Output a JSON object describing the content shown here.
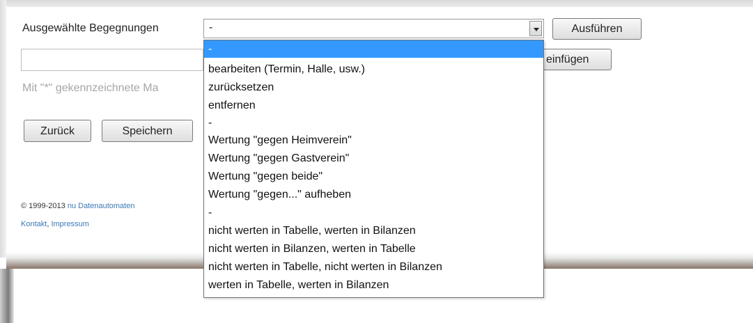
{
  "form": {
    "selected_label": "Ausgewählte Begegnungen",
    "select_value": "-",
    "execute_button": "Ausführen",
    "insert_button_visible_text": "einfügen",
    "hint_text": "Mit \"*\" gekennzeichnete Ma",
    "back_button": "Zurück",
    "save_button": "Speichern"
  },
  "footer": {
    "copyright": "© 1999-2013",
    "company_link": "nu Datenautomaten",
    "contact_link": "Kontakt",
    "separator": ",",
    "imprint_link": "Impressum"
  },
  "dropdown": {
    "options": [
      "-",
      "bearbeiten (Termin, Halle, usw.)",
      "zurücksetzen",
      "entfernen",
      "-",
      "Wertung \"gegen Heimverein\"",
      "Wertung \"gegen Gastverein\"",
      "Wertung \"gegen beide\"",
      "Wertung \"gegen...\" aufheben",
      "-",
      "nicht werten in Tabelle, werten in Bilanzen",
      "nicht werten in Bilanzen, werten in Tabelle",
      "nicht werten in Tabelle, nicht werten in Bilanzen",
      "werten in Tabelle, werten in Bilanzen"
    ],
    "selected_index": 0
  },
  "colors": {
    "highlight": "#3399ff",
    "link": "#3b79b6"
  }
}
